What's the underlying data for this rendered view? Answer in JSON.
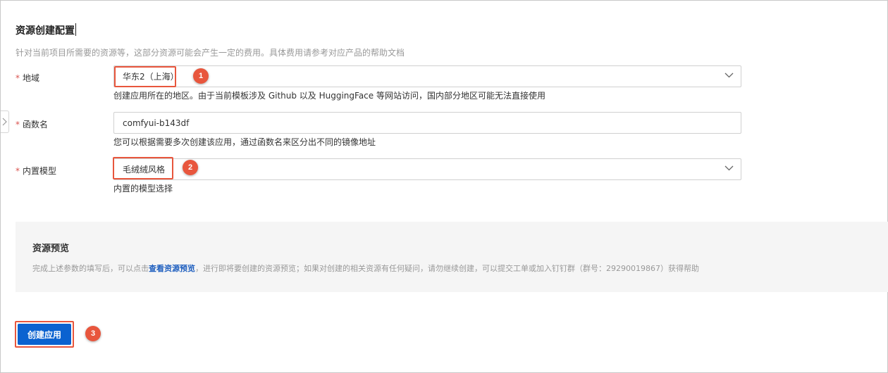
{
  "resource_config": {
    "title": "资源创建配置",
    "description": "针对当前项目所需要的资源等，这部分资源可能会产生一定的费用。具体费用请参考对应产品的帮助文档"
  },
  "form": {
    "region": {
      "required_mark": "*",
      "label": "地域",
      "value": "华东2（上海）",
      "hint": "创建应用所在的地区。由于当前模板涉及 Github 以及 HuggingFace 等网站访问，国内部分地区可能无法直接使用"
    },
    "function_name": {
      "required_mark": "*",
      "label": "函数名",
      "value": "comfyui-b143df",
      "hint": "您可以根据需要多次创建该应用，通过函数名来区分出不同的镜像地址"
    },
    "builtin_model": {
      "required_mark": "*",
      "label": "内置模型",
      "value": "毛绒绒风格",
      "hint": "内置的模型选择"
    }
  },
  "resource_preview": {
    "title": "资源预览",
    "text_before": "完成上述参数的填写后，可以点击",
    "link": "查看资源预览",
    "text_after": "，进行即将要创建的资源预览；如果对创建的相关资源有任何疑问，请勿继续创建，可以提交工单或加入钉钉群（群号：29290019867）获得帮助"
  },
  "actions": {
    "create_label": "创建应用"
  },
  "annotations": {
    "badge_1": "1",
    "badge_2": "2",
    "badge_3": "3"
  },
  "icons": {
    "side_toggle": "chevron-right-icon",
    "select_arrow": "chevron-down-icon"
  },
  "colors": {
    "accent": "#0b62d0",
    "highlight": "#e8563d",
    "required": "#d9534f",
    "link": "#1f5fbf"
  }
}
